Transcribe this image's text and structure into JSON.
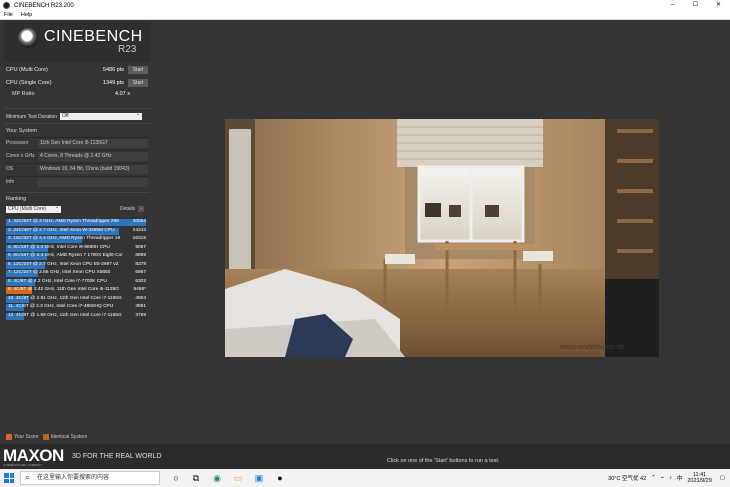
{
  "window": {
    "title": "CINEBENCH R23.200",
    "min": "–",
    "max": "☐",
    "close": "✕"
  },
  "menu": [
    "File",
    "Help"
  ],
  "logo": {
    "brand": "CINEBENCH",
    "version": "R23"
  },
  "scores": [
    {
      "label": "CPU (Multi Core)",
      "pts": "5486 pts",
      "button": "Start"
    },
    {
      "label": "CPU (Single Core)",
      "pts": "1349 pts",
      "button": "Start"
    }
  ],
  "mp_ratio": {
    "label": "MP Ratio",
    "value": "4.07 x"
  },
  "min_test_duration": {
    "label": "Minimum Test Duration",
    "value": "Off"
  },
  "system": {
    "heading": "Your System",
    "rows": [
      {
        "k": "Processor",
        "v": "11th Gen Intel Core i5-1135G7"
      },
      {
        "k": "Cores x GHz",
        "v": "4 Cores, 8 Threads @ 2.42 GHz"
      },
      {
        "k": "OS",
        "v": "Windows 10, 64 Bit, China (build 19043)"
      },
      {
        "k": "Info",
        "v": ""
      }
    ]
  },
  "ranking": {
    "heading": "Ranking",
    "select": "CPU (Multi Core)",
    "details": "Details",
    "rows": [
      {
        "text": "1. 32C/64T @ 3 GHz, AMD Ryzen Threadripper 299",
        "score": "30054",
        "value": 30054,
        "current": false
      },
      {
        "text": "2. 24C/48T @ 2.7 GHz, Intel Xeon W-3265M CPU",
        "score": "24243",
        "value": 24243,
        "current": false
      },
      {
        "text": "3. 16C/32T @ 3.4 GHz, AMD Ryzen Threadripper 19",
        "score": "16315",
        "value": 16315,
        "current": false
      },
      {
        "text": "4. 8C/16T @ 2.3 GHz, Intel Core i9-9880H CPU",
        "score": "9087",
        "value": 9087,
        "current": false
      },
      {
        "text": "5. 8C/16T @ 3.4 GHz, AMD Ryzen 7 1700X Eight-Cor",
        "score": "8889",
        "value": 8889,
        "current": false
      },
      {
        "text": "6. 12C/24T @ 2.7 GHz, Intel Xeon CPU E5-2697 v2",
        "score": "8378",
        "value": 8378,
        "current": false
      },
      {
        "text": "7. 12C/24T @ 2.66 GHz, Intel Xeon CPU X5650",
        "score": "6867",
        "value": 6867,
        "current": false
      },
      {
        "text": "8. 4C/8T @ 4.2 GHz, Intel Core i7-7700K CPU",
        "score": "6302",
        "value": 6302,
        "current": false
      },
      {
        "text": "9. 4C/8T @ 2.42 GHz, 11th Gen Intel Core i5-1135G",
        "score": "5486*",
        "value": 5486,
        "current": true
      },
      {
        "text": "10. 4C/8T @ 2.81 GHz, 11th Gen Intel Core i7-1165G",
        "score": "4904",
        "value": 4904,
        "current": false
      },
      {
        "text": "11. 4C/8T @ 2.3 GHz, Intel Core i7-4850HQ CPU",
        "score": "3891",
        "value": 3891,
        "current": false
      },
      {
        "text": "12. 4C/8T @ 1.69 GHz, 11th Gen Intel Core i7-1165G",
        "score": "3769",
        "value": 3769,
        "current": false
      }
    ]
  },
  "legend": {
    "your_score": "Your Score",
    "identical": "Identical System"
  },
  "render": {
    "watermark": "www.renderbaron.de"
  },
  "footer": {
    "brand": "MAXON",
    "brand_sub": "A NEMETSCHEK COMPANY",
    "slogan": "3D FOR THE REAL WORLD",
    "hint": "Click on one of the 'Start' buttons to run a test."
  },
  "taskbar": {
    "search_placeholder": "在这里输入你要搜索的内容",
    "weather": "30°C 空气优 42",
    "lang": "中",
    "time": "11:41",
    "date": "2021/9/29"
  },
  "colors": {
    "bar": "#2f74b8",
    "current": "#d26a1b"
  }
}
